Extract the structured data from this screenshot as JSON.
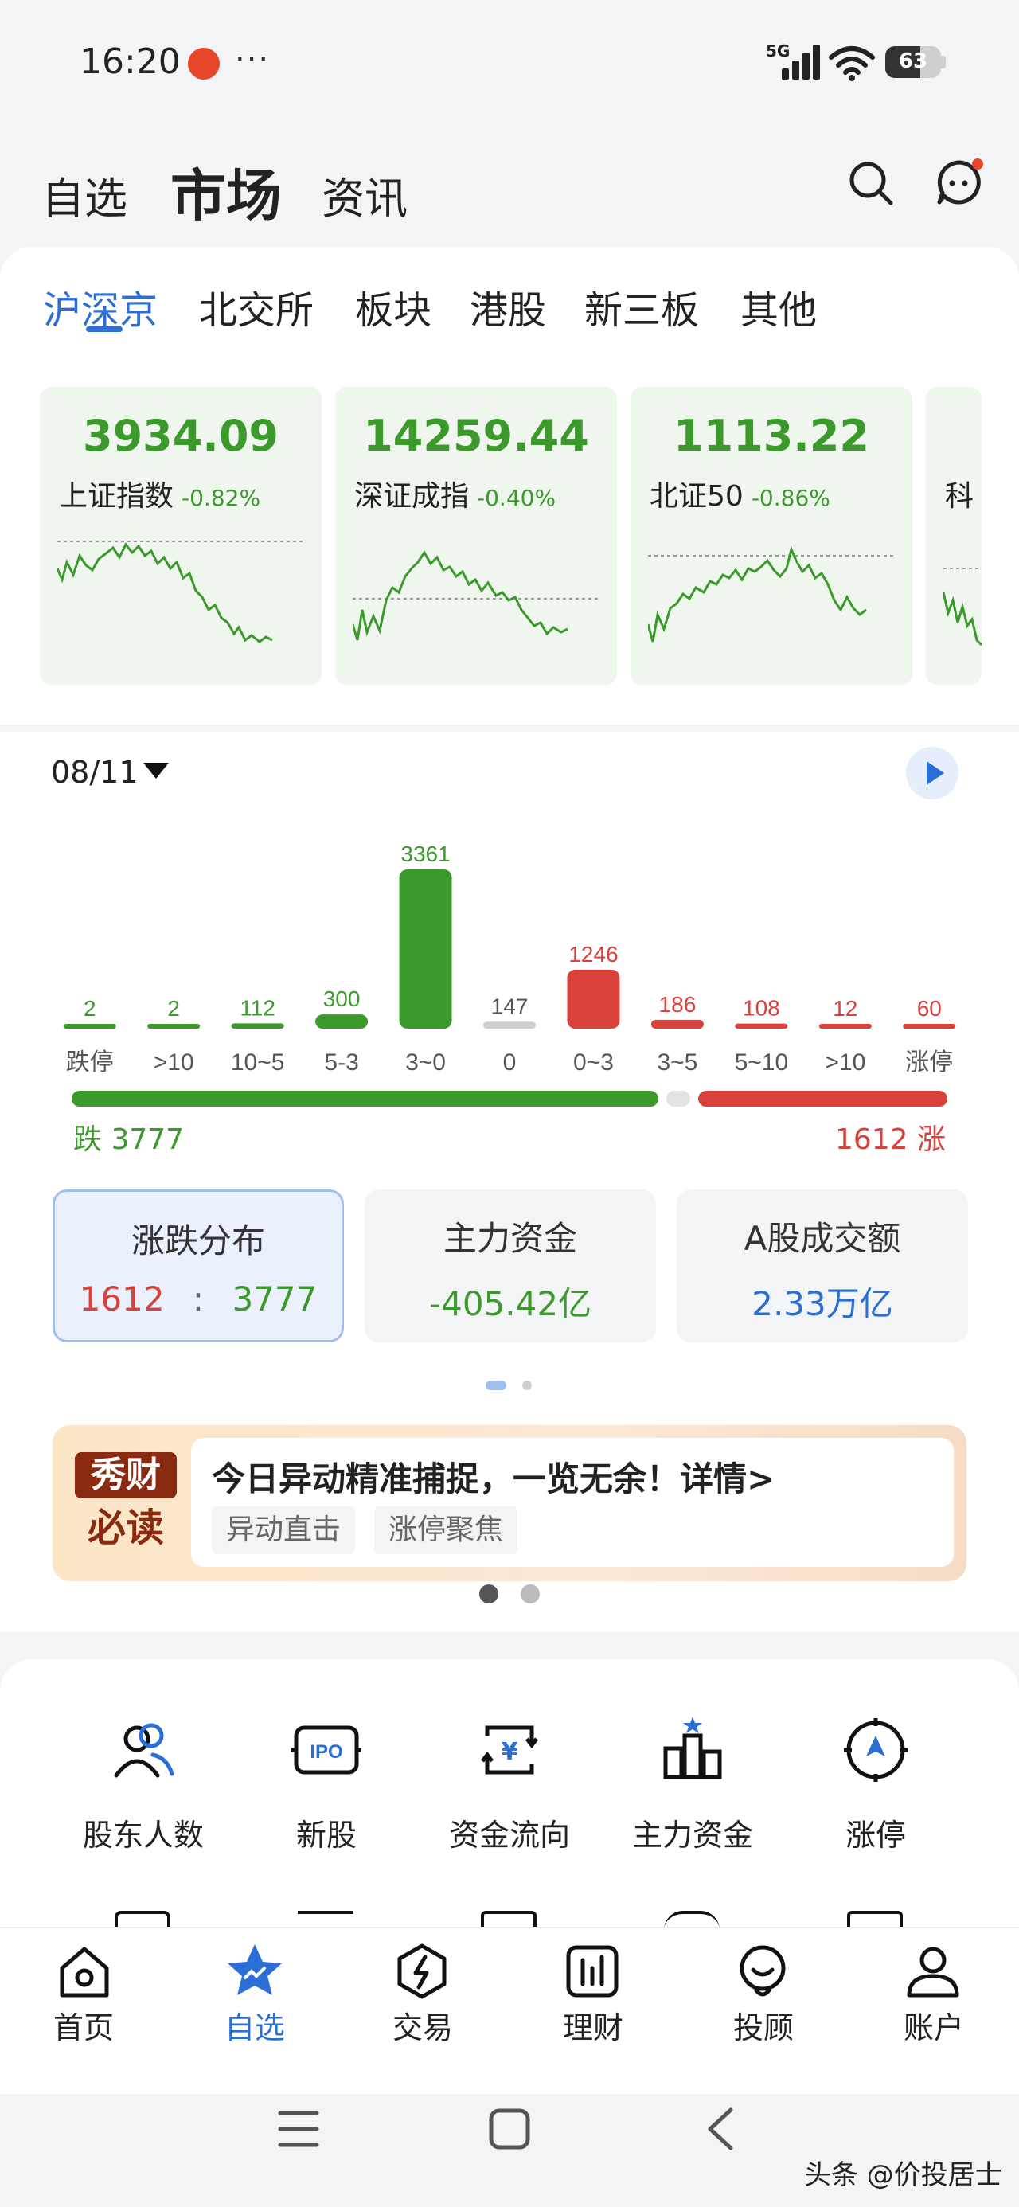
{
  "status_bar": {
    "time": "16:20",
    "more": "···",
    "network": "5G",
    "battery": "63",
    "battery_level": 0.63
  },
  "header": {
    "tabs": [
      "自选",
      "市场",
      "资讯"
    ],
    "active_tab": "市场"
  },
  "market_tabs": [
    "沪深京",
    "北交所",
    "板块",
    "港股",
    "新三板",
    "其他"
  ],
  "indices": [
    {
      "value": "3934.09",
      "name": "上证指数",
      "change": "-0.82%"
    },
    {
      "value": "14259.44",
      "name": "深证成指",
      "change": "-0.40%"
    },
    {
      "value": "1113.22",
      "name": "北证50",
      "change": "-0.86%"
    },
    {
      "value": "",
      "name": "科",
      "change": ""
    }
  ],
  "distribution": {
    "date": "08/11",
    "fall_label": "跌 3777",
    "rise_label": "1612 涨",
    "fall_total": 3777,
    "flat_total": 147,
    "rise_total": 1612
  },
  "chart_data": {
    "type": "bar",
    "categories": [
      "跌停",
      ">10",
      "10~5",
      "5-3",
      "3~0",
      "0",
      "0~3",
      "3~5",
      "5~10",
      ">10",
      "涨停"
    ],
    "values": [
      2,
      2,
      112,
      300,
      3361,
      147,
      1246,
      186,
      108,
      12,
      60
    ],
    "value_labels": [
      "2",
      "2",
      "112",
      "300",
      "3361",
      "147",
      "1246",
      "186",
      "108",
      "12",
      "60"
    ],
    "bar_colors": [
      "#3b9a2b",
      "#3b9a2b",
      "#3b9a2b",
      "#3b9a2b",
      "#3b9a2b",
      "#cfcfcf",
      "#d8423a",
      "#d8423a",
      "#d8423a",
      "#d8423a",
      "#d8423a"
    ],
    "ylim": [
      0,
      3361
    ],
    "grid": false,
    "legend": "none"
  },
  "stats": [
    {
      "title": "涨跌分布",
      "rise": "1612",
      "sep": ":",
      "fall": "3777"
    },
    {
      "title": "主力资金",
      "value": "-405.42亿"
    },
    {
      "title": "A股成交额",
      "value": "2.33万亿"
    }
  ],
  "banner": {
    "logo_top": "秀财",
    "logo_bottom": "必读",
    "headline": "今日异动精准捕捉，一览无余！详情>",
    "tags": [
      "异动直击",
      "涨停聚焦"
    ]
  },
  "tools": [
    {
      "label": "股东人数",
      "icon": "shareholders-icon"
    },
    {
      "label": "新股",
      "icon": "ipo-icon"
    },
    {
      "label": "资金流向",
      "icon": "fund-flow-icon"
    },
    {
      "label": "主力资金",
      "icon": "main-capital-icon"
    },
    {
      "label": "涨停",
      "icon": "limit-up-icon"
    }
  ],
  "bottom_nav": {
    "items": [
      "首页",
      "自选",
      "交易",
      "理财",
      "投顾",
      "账户"
    ],
    "active": "自选"
  },
  "watermark": "头条 @价投居士",
  "colors": {
    "green": "#3b9a2b",
    "red": "#d8423a",
    "accent": "#2b6fd6"
  }
}
